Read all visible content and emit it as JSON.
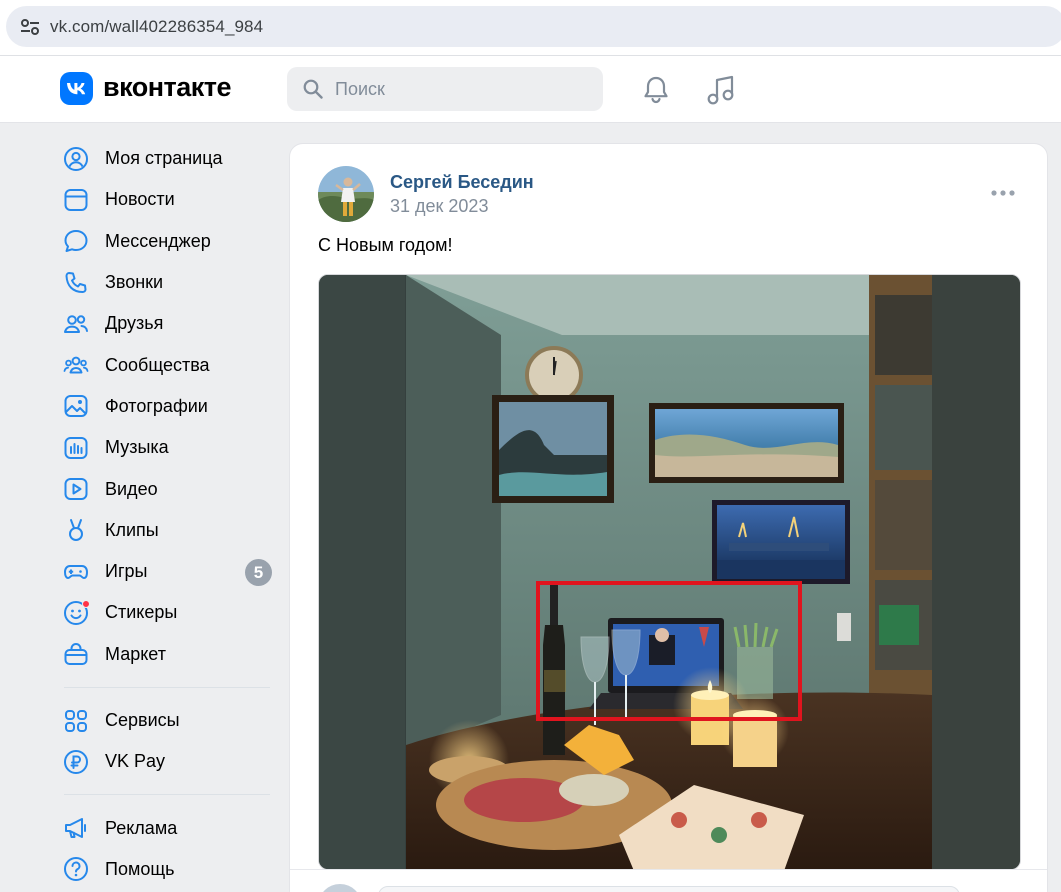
{
  "browser": {
    "url": "vk.com/wall402286354_984"
  },
  "header": {
    "logo_text": "вконтакте",
    "search_placeholder": "Поиск"
  },
  "sidebar": {
    "items": [
      {
        "label": "Моя страница",
        "icon": "user-circle-icon"
      },
      {
        "label": "Новости",
        "icon": "news-icon"
      },
      {
        "label": "Мессенджер",
        "icon": "message-icon"
      },
      {
        "label": "Звонки",
        "icon": "phone-icon"
      },
      {
        "label": "Друзья",
        "icon": "friends-icon"
      },
      {
        "label": "Сообщества",
        "icon": "communities-icon"
      },
      {
        "label": "Фотографии",
        "icon": "photos-icon"
      },
      {
        "label": "Музыка",
        "icon": "music-note-icon"
      },
      {
        "label": "Видео",
        "icon": "video-icon"
      },
      {
        "label": "Клипы",
        "icon": "clips-icon"
      },
      {
        "label": "Игры",
        "icon": "gamepad-icon",
        "badge": "5"
      },
      {
        "label": "Стикеры",
        "icon": "sticker-icon"
      },
      {
        "label": "Маркет",
        "icon": "market-bag-icon"
      }
    ],
    "items2": [
      {
        "label": "Сервисы",
        "icon": "services-grid-icon"
      },
      {
        "label": "VK Pay",
        "icon": "vkpay-icon"
      }
    ],
    "items3": [
      {
        "label": "Реклама",
        "icon": "megaphone-icon"
      },
      {
        "label": "Помощь",
        "icon": "help-icon"
      }
    ]
  },
  "post": {
    "author": "Сергей Беседин",
    "date": "31 дек 2023",
    "text": "С Новым годом!"
  },
  "colors": {
    "accent": "#0077ff",
    "author_link": "#2a5885",
    "highlight_box": "#e0141e"
  }
}
